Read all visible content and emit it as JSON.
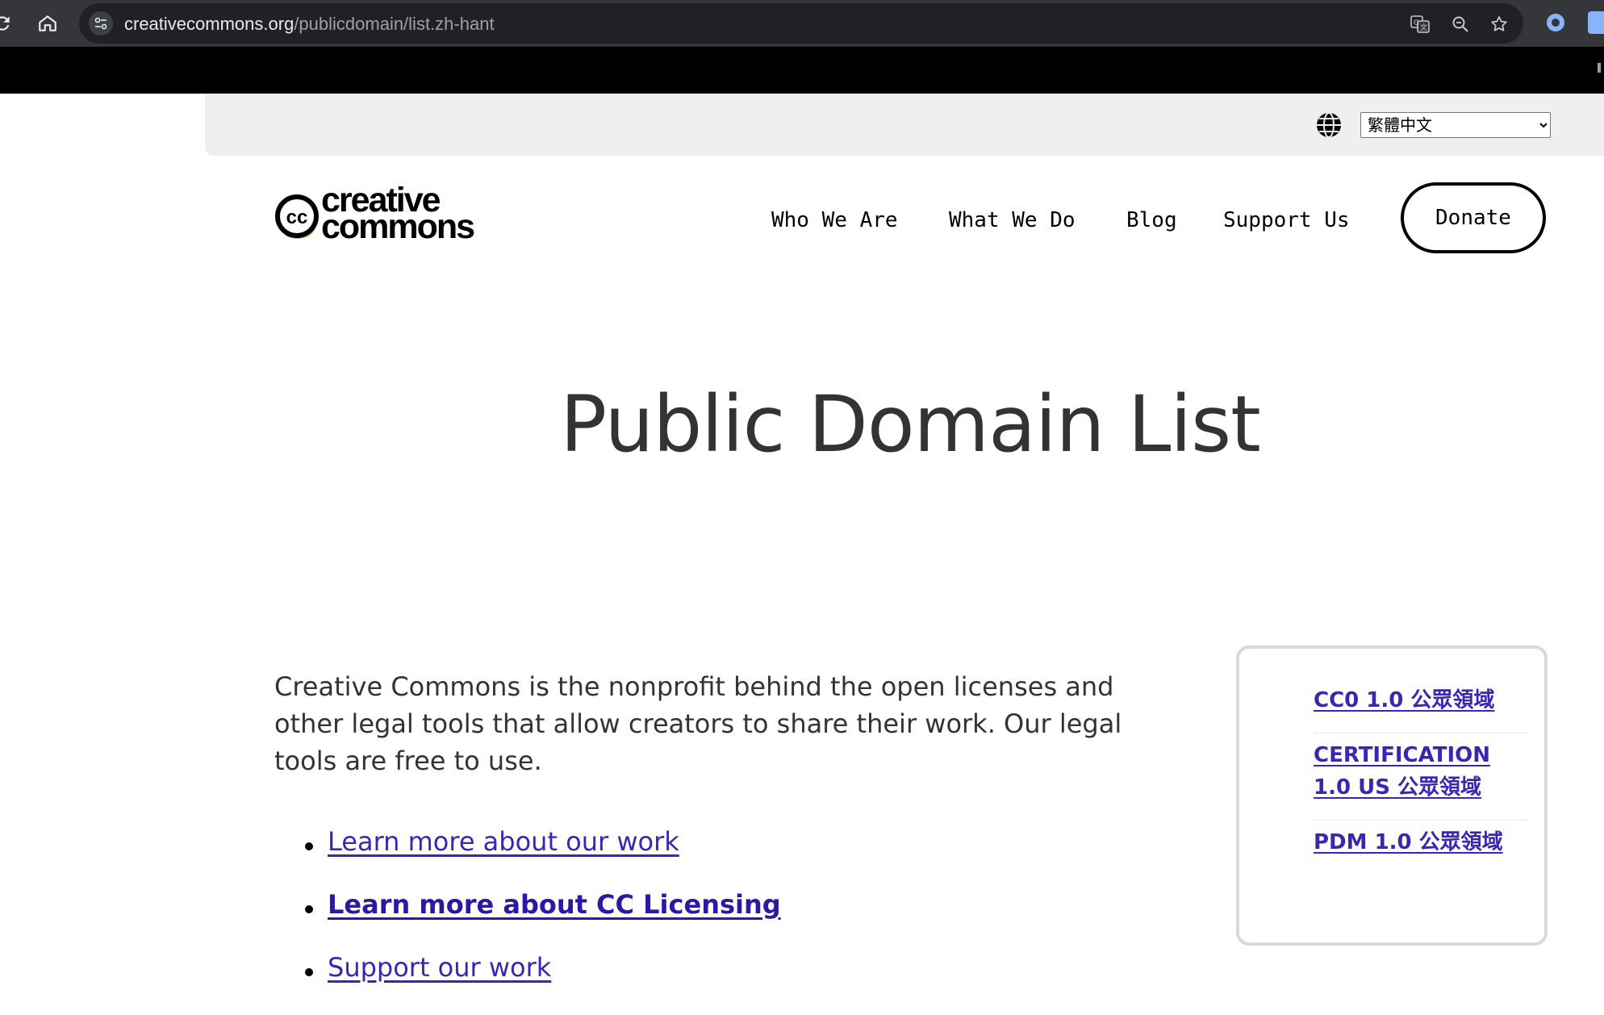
{
  "browser": {
    "url_host": "creativecommons.org",
    "url_path": "/publicdomain/list.zh-hant"
  },
  "lang_bar": {
    "selected_language": "繁體中文",
    "options": [
      "繁體中文"
    ]
  },
  "header": {
    "logo_line1": "creative",
    "logo_line2": "commons",
    "logo_badge": "cc",
    "nav": [
      "Who We Are",
      "What We Do",
      "Blog",
      "Support Us"
    ],
    "donate_label": "Donate"
  },
  "main": {
    "title": "Public Domain List",
    "intro": "Creative Commons is the nonprofit behind the open licenses and other legal tools that allow creators to share their work. Our legal tools are free to use.",
    "links": [
      "Learn more about our work",
      "Learn more about CC Licensing",
      "Support our work"
    ]
  },
  "sidebar": {
    "items": [
      "CC0 1.0 公眾領域",
      "CERTIFICATION 1.0 US 公眾領域",
      "PDM 1.0 公眾領域"
    ]
  },
  "colors": {
    "link": "#3b26b3",
    "chrome_bg": "#35363a",
    "omnibox_bg": "#202124",
    "lang_bar_bg": "#efefef",
    "cc_accent": "#8fc25b"
  }
}
